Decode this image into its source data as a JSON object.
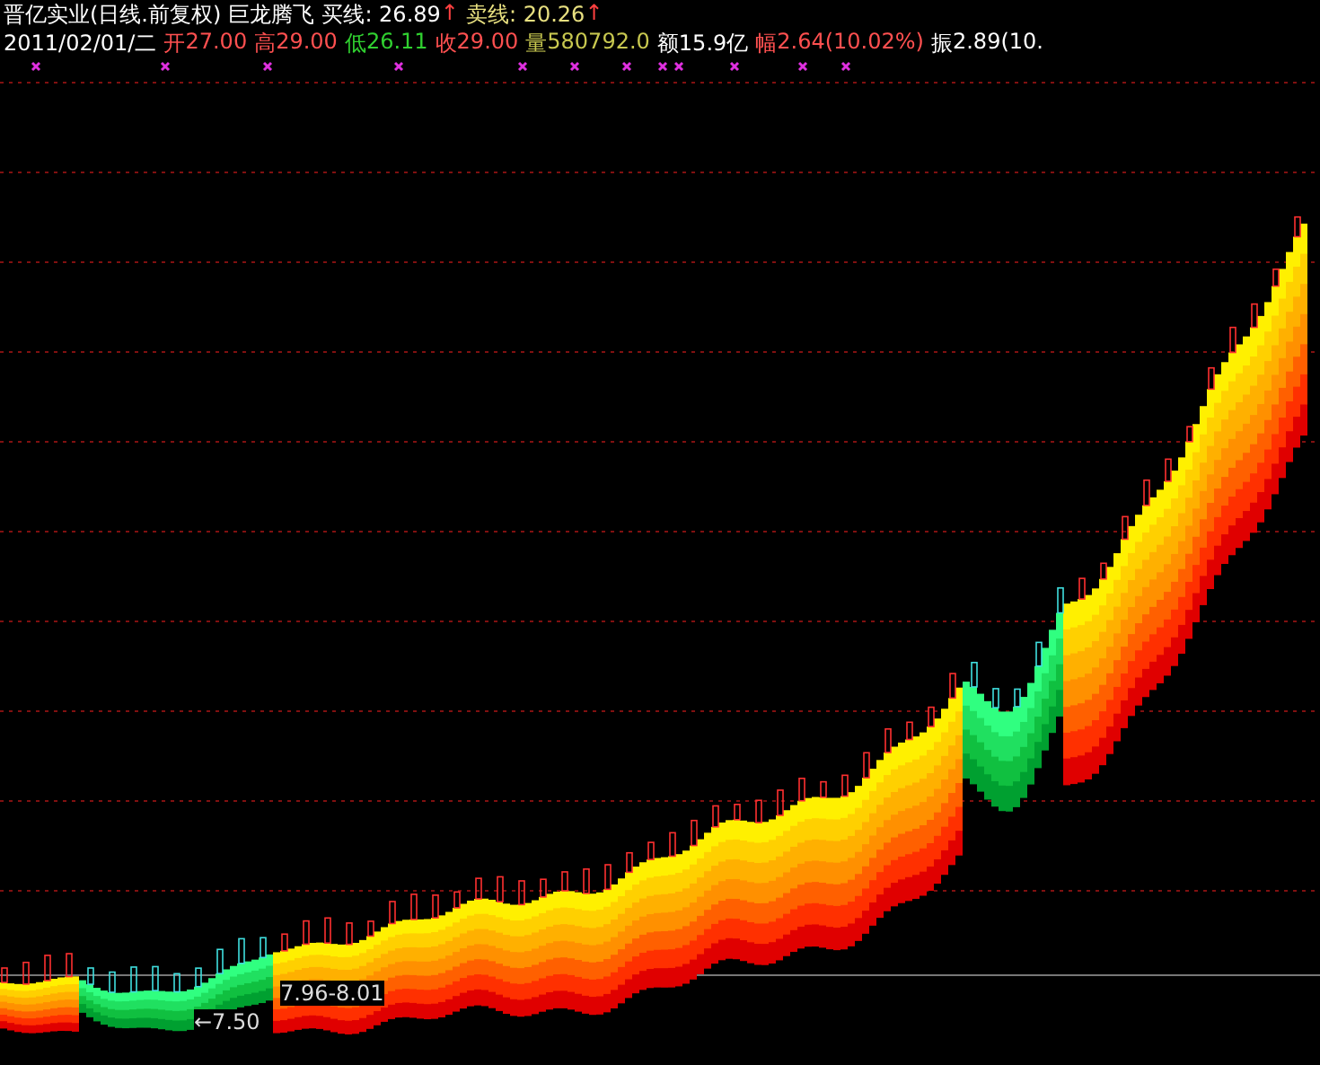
{
  "title": {
    "stock": "晋亿实业(日线.前复权)",
    "indicator": "巨龙腾飞",
    "lines": [
      {
        "label": "买线: 26.89",
        "arrow": "↑",
        "kind": "buy"
      },
      {
        "label": "卖线: 20.26",
        "arrow": "↑",
        "kind": "sell"
      }
    ]
  },
  "quote": {
    "date": "2011/02/01/二",
    "fields": [
      {
        "label": "开",
        "value": "27.00",
        "kind": "up"
      },
      {
        "label": "高",
        "value": "29.00",
        "kind": "up"
      },
      {
        "label": "低",
        "value": "26.11",
        "kind": "down"
      },
      {
        "label": "收",
        "value": "29.00",
        "kind": "up"
      },
      {
        "label": "量",
        "value": "580792.0",
        "kind": "volume"
      },
      {
        "label": "额",
        "value": "15.9亿",
        "kind": "plain"
      },
      {
        "label": "幅",
        "value": "2.64(10.02%)",
        "kind": "up"
      },
      {
        "label": "振",
        "value": "2.89(10.",
        "kind": "plain"
      }
    ]
  },
  "chart": {
    "low_label": "←7.50",
    "range_label": "7.96-8.01"
  }
}
